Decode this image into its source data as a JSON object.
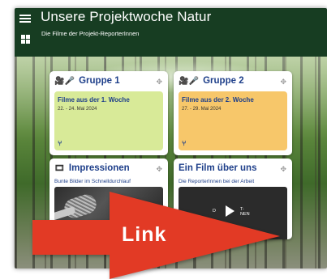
{
  "header": {
    "title": "Unsere Projektwoche Natur",
    "subtitle": "Die Filme der Projekt-ReporterInnen",
    "bg_color": "#173d22"
  },
  "cards": [
    {
      "title": "Gruppe 1",
      "icon": "camera-mic-icon",
      "tile_title": "Filme aus der 1. Woche",
      "tile_date": "22. - 24. Mai 2024",
      "tile_color": "#d8ea98"
    },
    {
      "title": "Gruppe 2",
      "icon": "camera-mic-icon",
      "tile_title": "Filme aus der 2. Woche",
      "tile_date": "27. - 29. Mai 2024",
      "tile_color": "#f7c76a"
    },
    {
      "title": "Impressionen",
      "icon": "film-icon",
      "description": "Bunte Bilder im Schnelldurchlauf"
    },
    {
      "title": "Ein Film über uns",
      "description": "Die ReporterInnen bei der Arbeit",
      "video_text_left": "D",
      "video_text_right": "T-\nNEN"
    }
  ],
  "overlay": {
    "label": "Link",
    "color": "#e23a25"
  }
}
